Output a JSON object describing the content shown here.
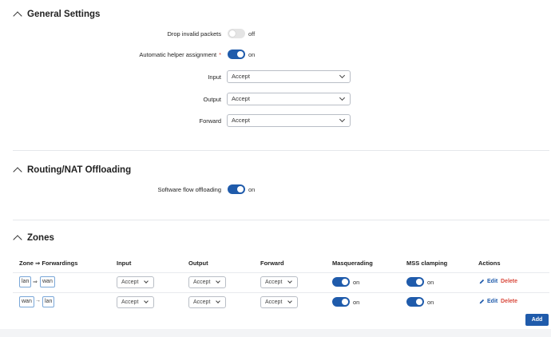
{
  "general": {
    "title": "General Settings",
    "drop_invalid": {
      "label": "Drop invalid packets",
      "state": "off"
    },
    "auto_helper": {
      "label": "Automatic helper assignment",
      "required_mark": "*",
      "state": "on"
    },
    "input": {
      "label": "Input",
      "value": "Accept"
    },
    "output": {
      "label": "Output",
      "value": "Accept"
    },
    "forward": {
      "label": "Forward",
      "value": "Accept"
    }
  },
  "routing": {
    "title": "Routing/NAT Offloading",
    "flow_offload": {
      "label": "Software flow offloading",
      "state": "on"
    }
  },
  "zones": {
    "title": "Zones",
    "headers": [
      "Zone ⇒ Forwardings",
      "Input",
      "Output",
      "Forward",
      "Masquerading",
      "MSS clamping",
      "Actions"
    ],
    "rows": [
      {
        "from": "lan",
        "arrow": "⇒",
        "to": "wan",
        "input": "Accept",
        "output": "Accept",
        "forward": "Accept",
        "masq": "on",
        "mss": "on",
        "edit": "Edit",
        "delete": "Delete"
      },
      {
        "from": "wan",
        "arrow": "→",
        "to": "lan",
        "input": "Accept",
        "output": "Accept",
        "forward": "Accept",
        "masq": "on",
        "mss": "on",
        "edit": "Edit",
        "delete": "Delete"
      }
    ],
    "add_label": "Add"
  },
  "colors": {
    "accent": "#1f5bab",
    "danger": "#d94a3d"
  },
  "icons": {
    "collapse": "chevron-up-icon",
    "edit": "pencil-icon",
    "dropdown": "chevron-down-icon"
  }
}
